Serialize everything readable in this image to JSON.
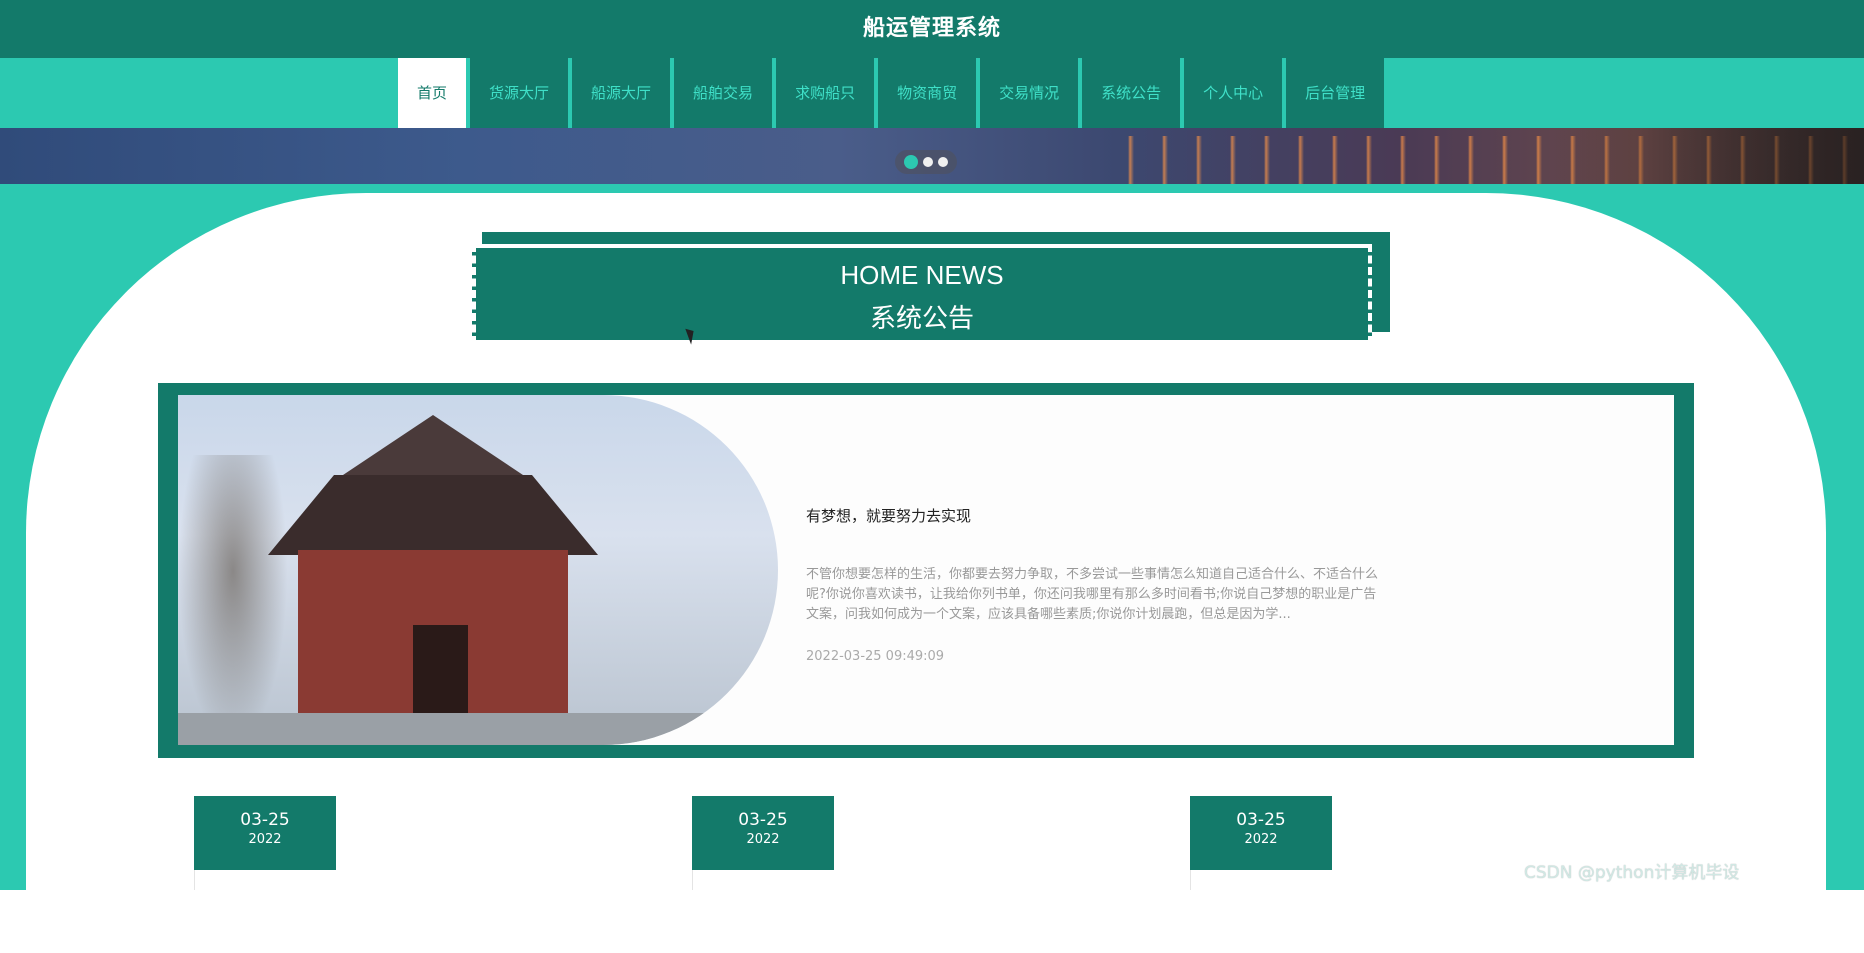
{
  "app": {
    "title": "船运管理系统"
  },
  "nav": {
    "items": [
      {
        "label": "首页",
        "active": true
      },
      {
        "label": "货源大厅",
        "active": false
      },
      {
        "label": "船源大厅",
        "active": false
      },
      {
        "label": "船舶交易",
        "active": false
      },
      {
        "label": "求购船只",
        "active": false
      },
      {
        "label": "物资商贸",
        "active": false
      },
      {
        "label": "交易情况",
        "active": false
      },
      {
        "label": "系统公告",
        "active": false
      },
      {
        "label": "个人中心",
        "active": false
      },
      {
        "label": "后台管理",
        "active": false
      }
    ]
  },
  "banner": {
    "slide_count": 3,
    "active_slide": 1
  },
  "section": {
    "title_en": "HOME NEWS",
    "title_zh": "系统公告"
  },
  "featured": {
    "title": "有梦想，就要努力去实现",
    "desc": "不管你想要怎样的生活，你都要去努力争取，不多尝试一些事情怎么知道自己适合什么、不适合什么呢?你说你喜欢读书，让我给你列书单，你还问我哪里有那么多时间看书;你说自己梦想的职业是广告文案，问我如何成为一个文案，应该具备哪些素质;你说你计划晨跑，但总是因为学...",
    "date": "2022-03-25 09:49:09"
  },
  "news": [
    {
      "md": "03-25",
      "year": "2022"
    },
    {
      "md": "03-25",
      "year": "2022"
    },
    {
      "md": "03-25",
      "year": "2022"
    }
  ],
  "watermark": "CSDN @python计算机毕设",
  "colors": {
    "primary": "#137a6a",
    "accent": "#2cc9b1",
    "nav_text": "#3fe0c8"
  }
}
